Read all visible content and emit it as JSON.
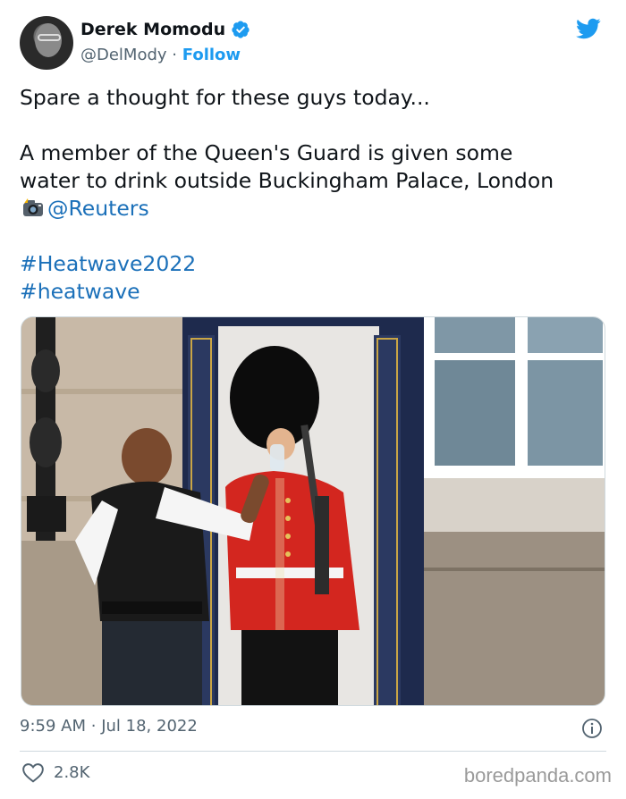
{
  "author": {
    "display_name": "Derek Momodu",
    "handle": "@DelMody",
    "separator": "·",
    "follow_label": "Follow"
  },
  "tweet": {
    "line1": "Spare a thought for these guys today...",
    "line2": "A member of the Queen's Guard is given some",
    "line3": "water to drink outside Buckingham Palace, London",
    "mention": "@Reuters",
    "hashtag1": "#Heatwave2022",
    "hashtag2": "#heatwave"
  },
  "meta": {
    "time": "9:59 AM",
    "separator": "·",
    "date": "Jul 18, 2022"
  },
  "engagement": {
    "likes": "2.8K"
  },
  "watermark": "boredpanda.com",
  "colors": {
    "link": "#1b70b9",
    "twitter_blue": "#1d9bf0",
    "muted": "#536471",
    "guard_red": "#d3261f"
  },
  "icons": [
    "avatar",
    "verified-badge-icon",
    "twitter-bird-icon",
    "camera-flash-icon",
    "info-icon",
    "heart-icon"
  ]
}
